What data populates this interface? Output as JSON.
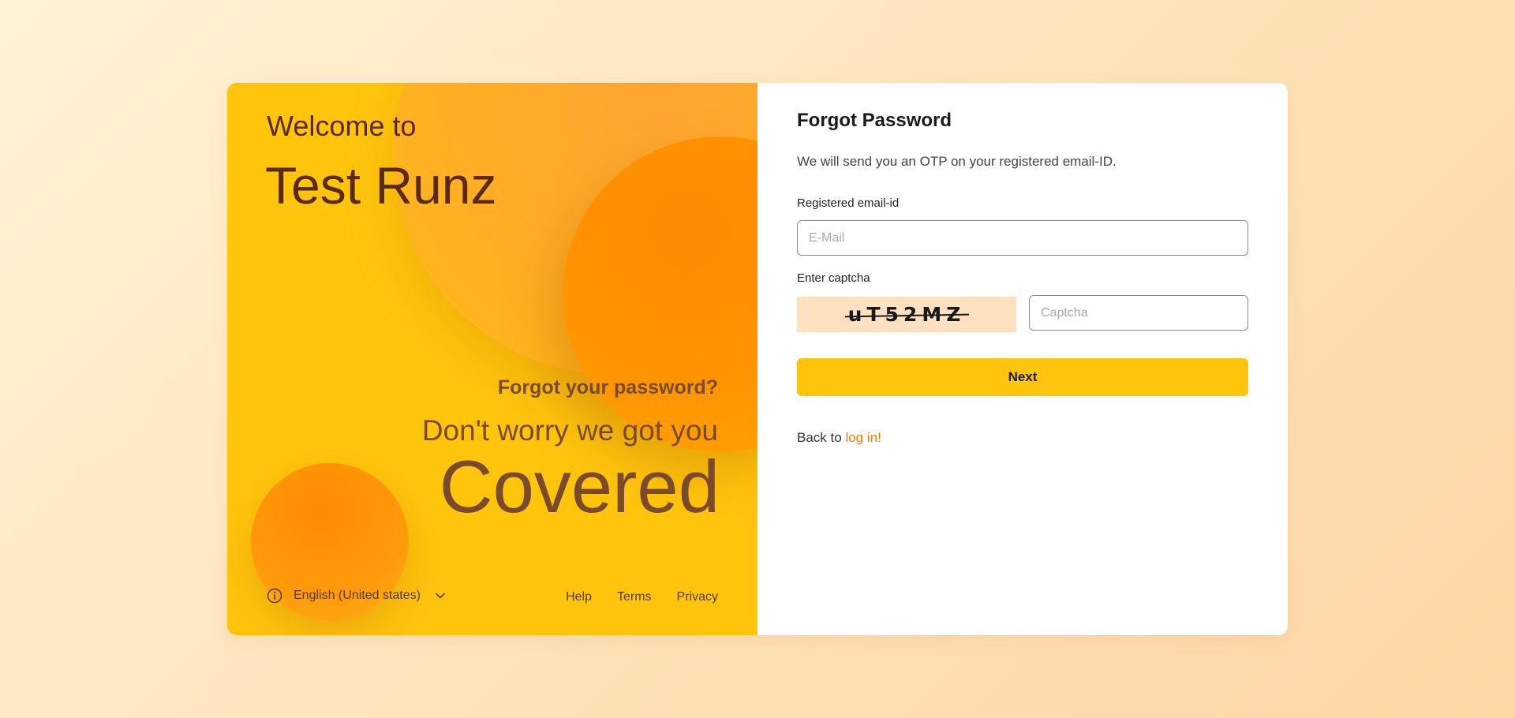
{
  "hero": {
    "welcome": "Welcome to",
    "brand": "Test Runz",
    "tagline_question": "Forgot your password?",
    "tagline_reassure": "Don't worry we got you",
    "tagline_big": "Covered"
  },
  "footer": {
    "info_icon": "info-icon",
    "language": "English (United states)",
    "language_dropdown_icon": "chevron-down-icon",
    "links": [
      "Help",
      "Terms",
      "Privacy"
    ]
  },
  "form": {
    "title": "Forgot Password",
    "description": "We will send you an OTP on your registered email-ID.",
    "email_label": "Registered email-id",
    "email_placeholder": "E-Mail",
    "email_value": "",
    "captcha_label": "Enter captcha",
    "captcha_code": "uT52MZ",
    "captcha_placeholder": "Captcha",
    "captcha_value": "",
    "next_label": "Next",
    "back_prefix": "Back to",
    "back_link": "log in!"
  },
  "colors": {
    "accent": "#ffc50d",
    "orange": "#ff8a00",
    "link": "#f57c00",
    "captcha_bg": "#ffe0c0"
  }
}
